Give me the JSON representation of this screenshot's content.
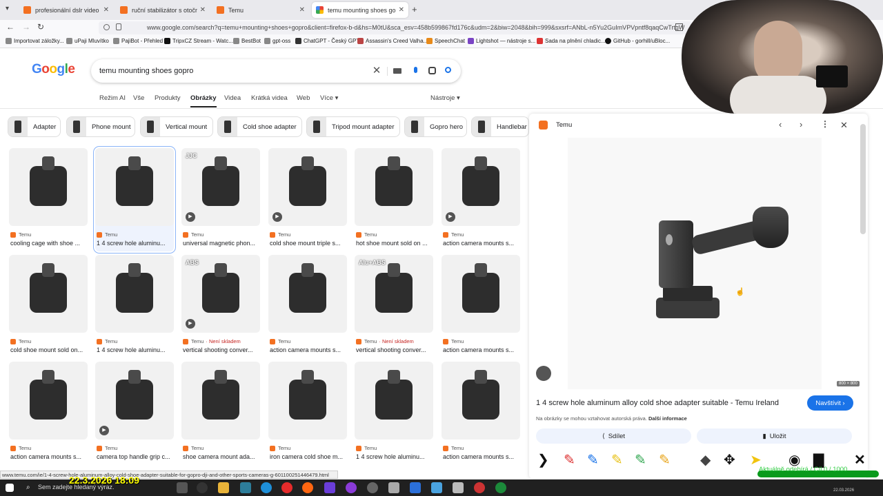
{
  "tabs": [
    {
      "label": "profesionální dslr video rig cage",
      "favicon": "temu"
    },
    {
      "label": "ruční stabilizátor s otočným gim",
      "favicon": "temu"
    },
    {
      "label": "Temu",
      "favicon": "temu"
    },
    {
      "label": "temu mounting shoes gopro - Hl",
      "favicon": "google",
      "active": true
    }
  ],
  "url": "www.google.com/search?q=temu+mounting+shoes+gopro&client=firefox-b-d&hs=M0tU&sca_esv=458b599867fd176c&udm=2&biw=2048&bih=999&sxsrf=ANbL-n5Yu2GuImVPVpntf8qaqCwTrtgW",
  "bookmarks": [
    "Importovat záložky...",
    "uPaji Mluvítko",
    "PajiBot - Přehled",
    "TripxCZ Stream - Watc...",
    "BestBot",
    "gpt-oss",
    "ChatGPT - Český GPT",
    "Assassin's Creed Valha...",
    "SpeechChat",
    "Lightshot — nástroje s...",
    "Sada na plnění chladic...",
    "GitHub - gorhill/uBloc..."
  ],
  "logo": "Google",
  "search_query": "temu mounting shoes gopro",
  "search_tabs": [
    "Režim AI",
    "Vše",
    "Produkty",
    "Obrázky",
    "Videa",
    "Krátká videa",
    "Web",
    "Více ▾"
  ],
  "tools_label": "Nástroje ▾",
  "chips": [
    "Adapter",
    "Phone mount",
    "Vertical mount",
    "Cold shoe adapter",
    "Tripod mount adapter",
    "Gopro hero",
    "Handlebar m"
  ],
  "results": [
    {
      "source": "Temu",
      "title": "cooling cage with shoe ..."
    },
    {
      "source": "Temu",
      "title": "1 4 screw hole aluminu..."
    },
    {
      "source": "Temu",
      "title": "universal magnetic phon...",
      "video": true,
      "badge": "JJC"
    },
    {
      "source": "Temu",
      "title": "cold shoe mount triple s...",
      "video": true
    },
    {
      "source": "Temu",
      "title": "hot shoe mount sold on ..."
    },
    {
      "source": "Temu",
      "title": "action camera mounts s...",
      "video": true
    },
    {
      "source": "Temu",
      "title": "cold shoe mount sold on..."
    },
    {
      "source": "Temu",
      "title": "1 4 screw hole aluminu..."
    },
    {
      "source": "Temu",
      "title": "vertical shooting conver...",
      "oos": "Není skladem",
      "video": true,
      "badge": "ABS"
    },
    {
      "source": "Temu",
      "title": "action camera mounts s..."
    },
    {
      "source": "Temu",
      "title": "vertical shooting conver...",
      "oos": "Není skladem",
      "badge": "Alu+ABS"
    },
    {
      "source": "Temu",
      "title": "action camera mounts s..."
    },
    {
      "source": "Temu",
      "title": "action camera mounts s..."
    },
    {
      "source": "Temu",
      "title": "camera top handle grip c...",
      "video": true
    },
    {
      "source": "Temu",
      "title": "shoe camera mount ada..."
    },
    {
      "source": "Temu",
      "title": "iron camera cold shoe m..."
    },
    {
      "source": "Temu",
      "title": "1 4 screw hole aluminu..."
    },
    {
      "source": "Temu",
      "title": "action camera mounts s..."
    }
  ],
  "panel": {
    "site": "Temu",
    "dims": "800 × 800",
    "title": "1 4 screw hole aluminum alloy cold shoe adapter suitable - Temu Ireland",
    "visit": "Navštívit ›",
    "copyright": "Na obrázky se mohou vztahovat autorská práva.",
    "more_info": "Další informace",
    "share": "Sdílet",
    "save": "Uložit"
  },
  "status_url": "www.temu.com/ie/1-4-screw-hole-aluminum-alloy-cold-shoe-adapter-suitable-for-gopro-dji-and-other-sports-cameras-g-601100251446479.html",
  "taskbar_search": "Sem zadejte hledaný výraz.",
  "overlay_clock": "22.3.2026 18:09",
  "goal_text": "Aktuálně odebírá / Cíl 0 / 1000",
  "goal_progress": 0,
  "taskbar_date": "22.03.2026",
  "colors": {
    "accent": "#1a73e8",
    "temu": "#f37021",
    "out_of_stock": "#c5221f"
  }
}
